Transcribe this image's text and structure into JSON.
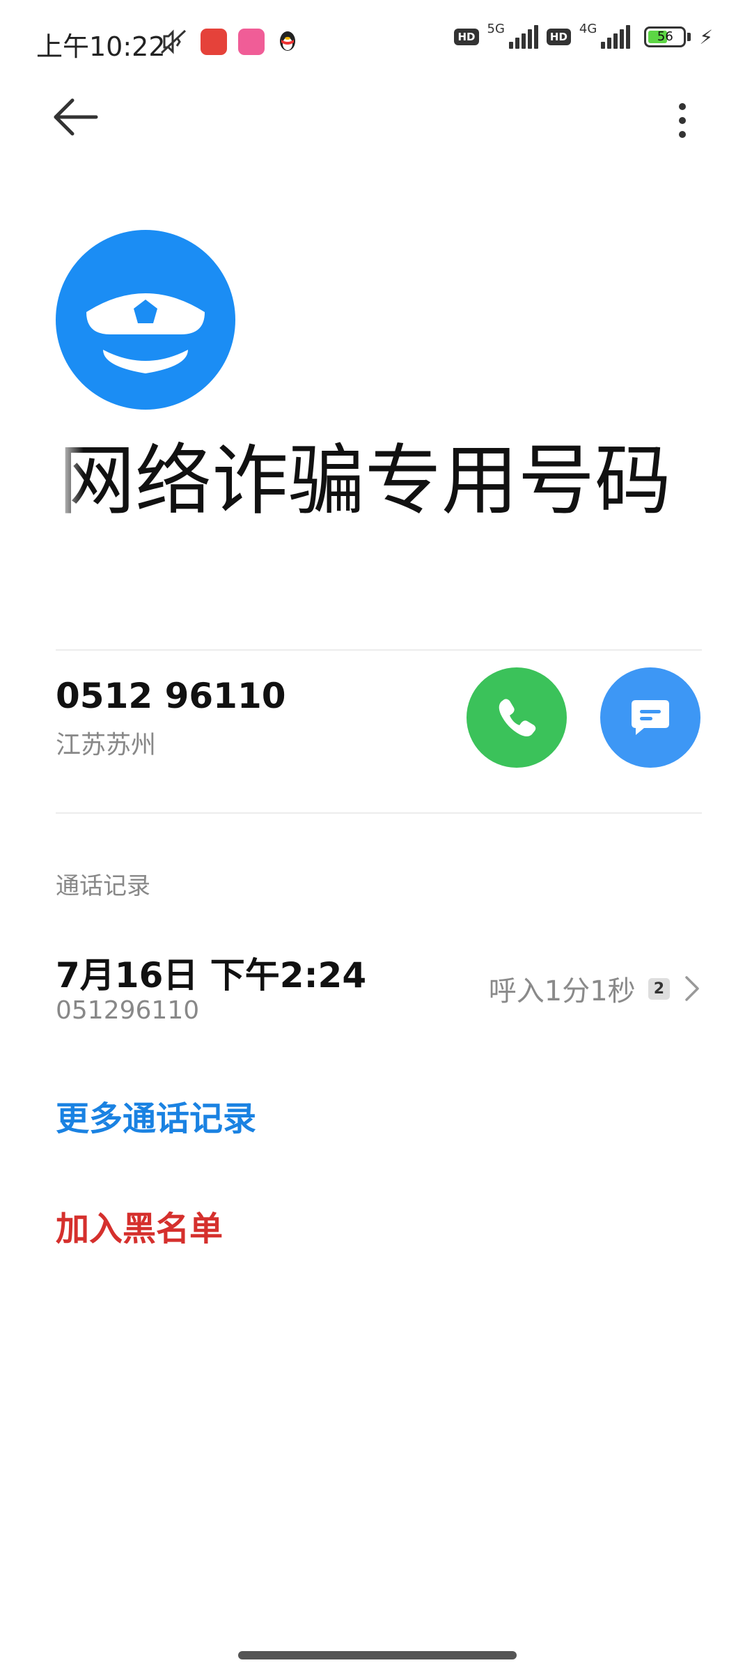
{
  "status_bar": {
    "time": "上午10:22",
    "net1": "5G",
    "net2": "4G",
    "hd": "HD",
    "battery": "56",
    "battery_level_percent": 56
  },
  "contact": {
    "name": "信网络诈骗专用号码",
    "avatar_icon": "police-cap-icon",
    "phone": "0512 96110",
    "location": "江苏苏州"
  },
  "history": {
    "section_title": "通话记录",
    "date": "7月16日 下午2:24",
    "number": "051296110",
    "type": "呼入1分1秒",
    "count": "2"
  },
  "actions": {
    "more_records": "更多通话记录",
    "blacklist": "加入黑名单"
  },
  "colors": {
    "avatar_bg": "#1b8df4",
    "call_green": "#3bc25a",
    "message_blue": "#3d97f5",
    "link_blue": "#1a82e2",
    "danger_red": "#d5302d"
  }
}
